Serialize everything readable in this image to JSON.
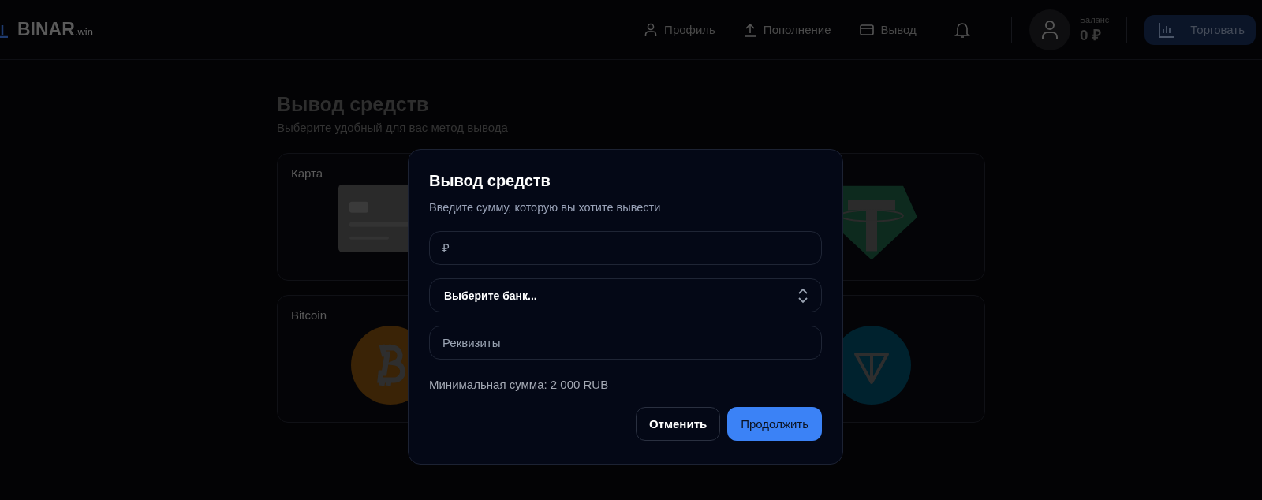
{
  "header": {
    "logo": {
      "name": "BINAR",
      "suffix": ".win"
    },
    "nav": [
      {
        "label": "Профиль",
        "kind": "user"
      },
      {
        "label": "Пополнение",
        "kind": "upload"
      },
      {
        "label": "Вывод",
        "kind": "card"
      }
    ],
    "balance": {
      "label": "Баланс",
      "value": "0 ₽"
    },
    "trade_button": "Торговать"
  },
  "page": {
    "title": "Вывод средств",
    "subtitle": "Выберите удобный для вас метод вывода",
    "methods": [
      {
        "label": "Карта",
        "kind": "card"
      },
      {
        "kind": "tether"
      },
      {
        "label": "Bitcoin",
        "kind": "bitcoin"
      },
      {
        "kind": "ton"
      }
    ]
  },
  "modal": {
    "title": "Вывод средств",
    "subtitle": "Введите сумму, которую вы хотите вывести",
    "amount_field": {
      "placeholder": "₽"
    },
    "bank_select": {
      "value": "Выберите банк..."
    },
    "details_field": {
      "placeholder": "Реквизиты"
    },
    "min_note": "Минимальная сумма: 2 000 RUB",
    "buttons": [
      {
        "label": "Отменить",
        "kind": "secondary"
      },
      {
        "label": "Продолжить",
        "kind": "primary"
      }
    ]
  }
}
